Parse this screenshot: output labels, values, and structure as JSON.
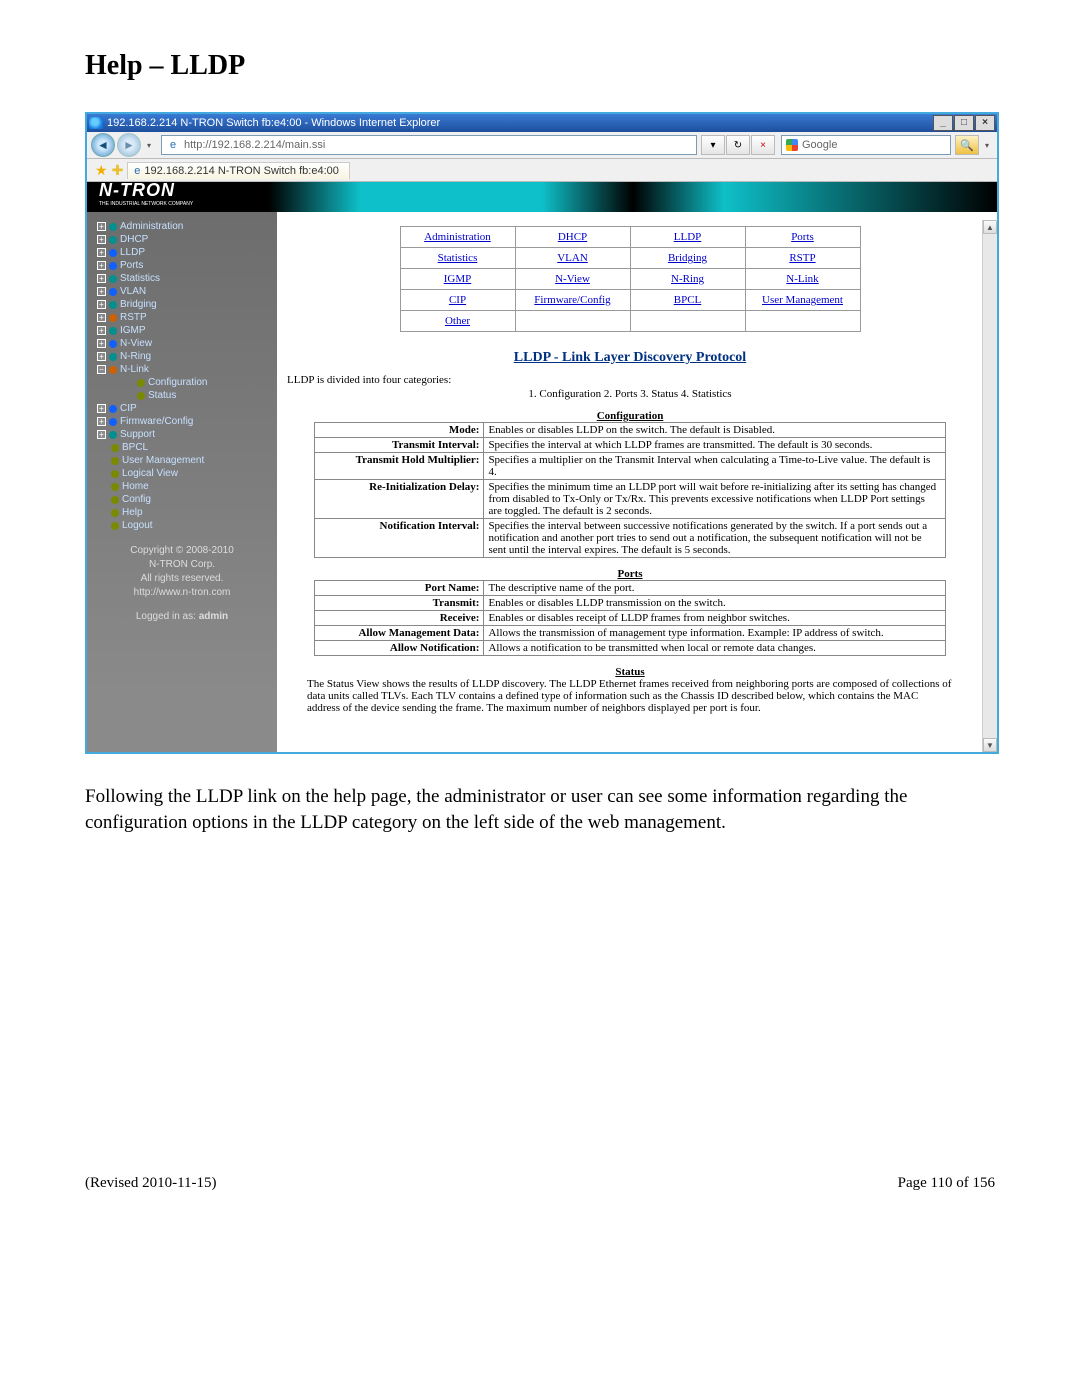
{
  "doc": {
    "heading": "Help – LLDP",
    "bodytext": "Following the LLDP link on the help page, the administrator or user can see some information regarding the configuration options in the LLDP category on the left side of the web management.",
    "footer_left": "(Revised 2010-11-15)",
    "footer_right": "Page 110 of 156"
  },
  "browser": {
    "title": "192.168.2.214 N-TRON Switch fb:e4:00 - Windows Internet Explorer",
    "url": "http://192.168.2.214/main.ssi",
    "search_placeholder": "Google",
    "tab": "192.168.2.214 N-TRON Switch fb:e4:00",
    "logo": "N-TRON",
    "logo_sub": "THE INDUSTRIAL NETWORK COMPANY"
  },
  "sidebar": {
    "items": [
      {
        "exp": "+",
        "dot": "d-teal",
        "label": "Administration"
      },
      {
        "exp": "+",
        "dot": "d-teal",
        "label": "DHCP"
      },
      {
        "exp": "+",
        "dot": "d-blue",
        "label": "LLDP"
      },
      {
        "exp": "+",
        "dot": "d-blue",
        "label": "Ports"
      },
      {
        "exp": "+",
        "dot": "d-teal",
        "label": "Statistics"
      },
      {
        "exp": "+",
        "dot": "d-blue",
        "label": "VLAN"
      },
      {
        "exp": "+",
        "dot": "d-teal",
        "label": "Bridging"
      },
      {
        "exp": "+",
        "dot": "d-orange",
        "label": "RSTP"
      },
      {
        "exp": "+",
        "dot": "d-teal",
        "label": "IGMP"
      },
      {
        "exp": "+",
        "dot": "d-blue",
        "label": "N-View"
      },
      {
        "exp": "+",
        "dot": "d-teal",
        "label": "N-Ring"
      },
      {
        "exp": "−",
        "dot": "d-orange",
        "label": "N-Link"
      },
      {
        "exp": "",
        "dot": "d-olive",
        "label": "Configuration",
        "indent": true
      },
      {
        "exp": "",
        "dot": "d-olive",
        "label": "Status",
        "indent": true
      },
      {
        "exp": "+",
        "dot": "d-blue",
        "label": "CIP"
      },
      {
        "exp": "+",
        "dot": "d-blue",
        "label": "Firmware/Config"
      },
      {
        "exp": "+",
        "dot": "d-teal",
        "label": "Support"
      },
      {
        "exp": "",
        "dot": "d-olive",
        "label": "BPCL"
      },
      {
        "exp": "",
        "dot": "d-olive",
        "label": "User Management"
      },
      {
        "exp": "",
        "dot": "d-olive",
        "label": "Logical View"
      },
      {
        "exp": "",
        "dot": "d-olive",
        "label": "Home"
      },
      {
        "exp": "",
        "dot": "d-olive",
        "label": "Config"
      },
      {
        "exp": "",
        "dot": "d-olive",
        "label": "Help"
      },
      {
        "exp": "",
        "dot": "d-olive",
        "label": "Logout"
      }
    ],
    "copyright": "Copyright © 2008-2010",
    "corp": "N-TRON Corp.",
    "rights": "All rights reserved.",
    "site": "http://www.n-tron.com",
    "login_label": "Logged in as:",
    "login_user": "admin"
  },
  "linkgrid": [
    [
      "Administration",
      "DHCP",
      "LLDP",
      "Ports"
    ],
    [
      "Statistics",
      "VLAN",
      "Bridging",
      "RSTP"
    ],
    [
      "IGMP",
      "N-View",
      "N-Ring",
      "N-Link"
    ],
    [
      "CIP",
      "Firmware/Config",
      "BPCL",
      "User Management"
    ],
    [
      "Other",
      "",
      "",
      ""
    ]
  ],
  "help": {
    "title": "LLDP - Link Layer Discovery Protocol",
    "intro": "LLDP is divided into four categories:",
    "cats": "1. Configuration  2. Ports  3. Status  4. Statistics",
    "sections": {
      "configuration": {
        "head": "Configuration",
        "rows": [
          {
            "k": "Mode:",
            "v": "Enables or disables LLDP on the switch. The default is Disabled."
          },
          {
            "k": "Transmit Interval:",
            "v": "Specifies the interval at which LLDP frames are transmitted. The default is 30 seconds."
          },
          {
            "k": "Transmit Hold Multiplier:",
            "v": "Specifies a multiplier on the Transmit Interval when calculating a Time-to-Live value. The default is 4."
          },
          {
            "k": "Re-Initialization Delay:",
            "v": "Specifies the minimum time an LLDP port will wait before re-initializing after its setting has changed from disabled to Tx-Only or Tx/Rx. This prevents excessive notifications when LLDP Port settings are toggled. The default is 2 seconds."
          },
          {
            "k": "Notification Interval:",
            "v": "Specifies the interval between successive notifications generated by the switch. If a port sends out a notification and another port tries to send out a notification, the subsequent notification will not be sent until the interval expires. The default is 5 seconds."
          }
        ]
      },
      "ports": {
        "head": "Ports",
        "rows": [
          {
            "k": "Port Name:",
            "v": "The descriptive name of the port."
          },
          {
            "k": "Transmit:",
            "v": "Enables or disables LLDP transmission on the switch."
          },
          {
            "k": "Receive:",
            "v": "Enables or disables receipt of LLDP frames from neighbor switches."
          },
          {
            "k": "Allow Management Data:",
            "v": "Allows the transmission of management type information. Example: IP address of switch."
          },
          {
            "k": "Allow Notification:",
            "v": "Allows a notification to be transmitted when local or remote data changes."
          }
        ]
      },
      "status": {
        "head": "Status",
        "text": "The Status View shows the results of LLDP discovery. The LLDP Ethernet frames received from neighboring ports are composed of collections of data units called TLVs. Each TLV contains a defined type of information such as the Chassis ID described below, which contains the MAC address of the device sending the frame. The maximum number of neighbors displayed per port is four."
      }
    }
  }
}
